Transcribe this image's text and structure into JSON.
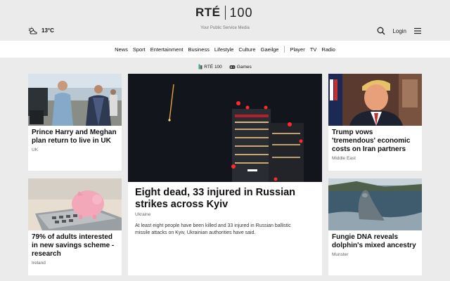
{
  "header": {
    "logo_text": "RTÉ",
    "logo_number": "100",
    "tagline": "Your Public Service Media",
    "weather_icon": "partly-cloudy-icon",
    "temperature": "13°C",
    "search_icon": "search-icon",
    "login_label": "Login",
    "menu_icon": "hamburger-menu-icon"
  },
  "nav": {
    "items": [
      "News",
      "Sport",
      "Entertainment",
      "Business",
      "Lifestyle",
      "Culture",
      "Gaeilge",
      "Player",
      "TV",
      "Radio"
    ]
  },
  "subnav": {
    "items": [
      {
        "label": "RTÉ 100",
        "icon": "rte100-icon"
      },
      {
        "label": "Games",
        "icon": "gamepad-icon"
      }
    ]
  },
  "articles": {
    "harry": {
      "title": "Prince Harry and Meghan plan return to live in UK",
      "section": "UK"
    },
    "hero": {
      "title": "Eight dead, 33 injured in Russian strikes across Kyiv",
      "section": "Ukraine",
      "summary": "At least eight people have been killed and 33 injured in Russian ballistic missile attacks on Kyiv, Ukrainian authorities have said."
    },
    "trump": {
      "title": "Trump vows 'tremendous' economic costs on Iran partners",
      "section": "Middle East"
    },
    "savings": {
      "title": "79% of adults interested in new savings scheme - research",
      "section": "Ireland"
    },
    "fungie": {
      "title": "Fungie DNA reveals dolphin's mixed ancestry",
      "section": "Munster"
    }
  },
  "colors": {
    "page_bg": "#ebebeb",
    "card_bg": "#ffffff",
    "text": "#111111",
    "muted": "#666666"
  }
}
